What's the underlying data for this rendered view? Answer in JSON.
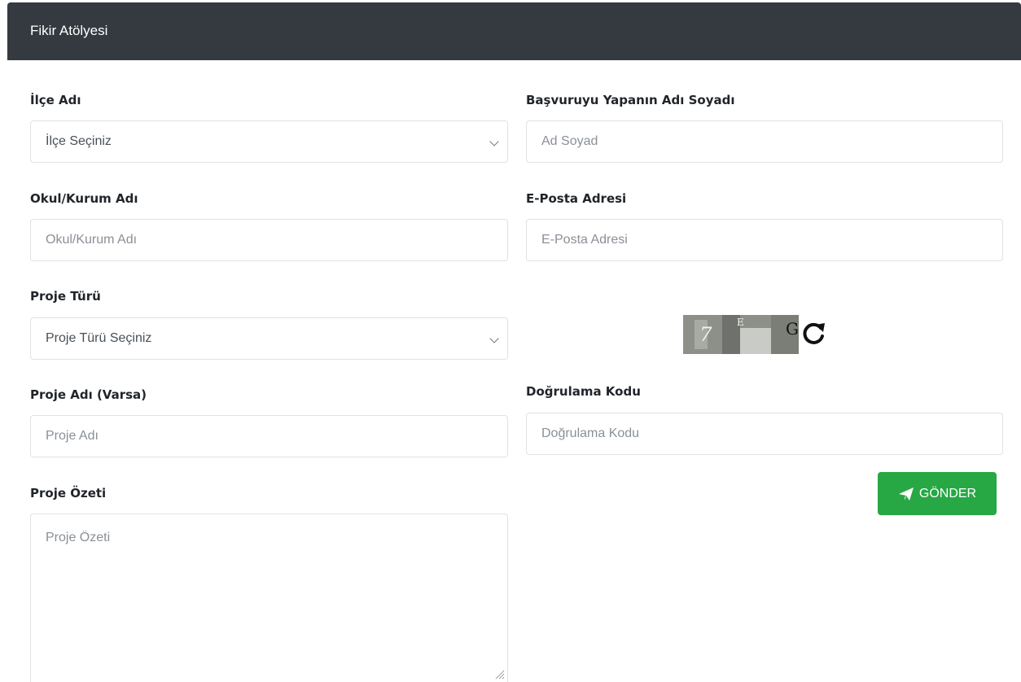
{
  "header": {
    "title": "Fikir Atölyesi"
  },
  "form": {
    "district": {
      "label": "İlçe Adı",
      "selected": "İlçe Seçiniz"
    },
    "applicant": {
      "label": "Başvuruyu Yapanın Adı Soyadı",
      "placeholder": "Ad Soyad"
    },
    "school": {
      "label": "Okul/Kurum Adı",
      "placeholder": "Okul/Kurum Adı"
    },
    "email": {
      "label": "E-Posta Adresi",
      "placeholder": "E-Posta Adresi"
    },
    "project_type": {
      "label": "Proje Türü",
      "selected": "Proje Türü Seçiniz"
    },
    "project_name": {
      "label": "Proje Adı (Varsa)",
      "placeholder": "Proje Adı"
    },
    "verification": {
      "label": "Doğrulama Kodu",
      "placeholder": "Doğrulama Kodu"
    },
    "summary": {
      "label": "Proje Özeti",
      "placeholder": "Proje Özeti"
    },
    "captcha": {
      "chars": [
        "7",
        "E",
        "G"
      ]
    },
    "submit_label": "GÖNDER"
  },
  "icons": {
    "refresh": "refresh-icon",
    "send": "paper-plane-icon"
  },
  "colors": {
    "header_bg": "#343a40",
    "button_bg": "#28a745"
  }
}
